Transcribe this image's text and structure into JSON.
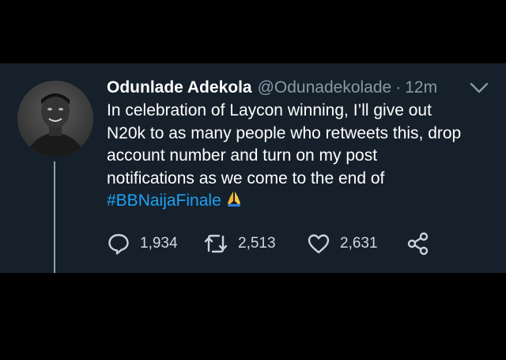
{
  "tweet": {
    "author_name": "Odunlade Adekola",
    "handle": "@Odunadekolade",
    "separator": "·",
    "time": "12m",
    "lines": [
      "In celebration of Laycon winning, I’ll give out",
      "N20k to as many people who retweets this, drop",
      "account number and turn on my post",
      "notifications as we come to the end of"
    ],
    "hashtag": "#BBNaijaFinale"
  },
  "actions": {
    "replies": "1,934",
    "retweets": "2,513",
    "likes": "2,631"
  },
  "icons": {
    "menu": "chevron-down-icon",
    "reply": "reply-icon",
    "retweet": "retweet-icon",
    "like": "heart-icon",
    "share": "share-icon",
    "emoji": "folded-hands-emoji"
  },
  "colors": {
    "background": "#15202b",
    "text": "#ffffff",
    "muted": "#8899a6",
    "link": "#1da1f2"
  }
}
